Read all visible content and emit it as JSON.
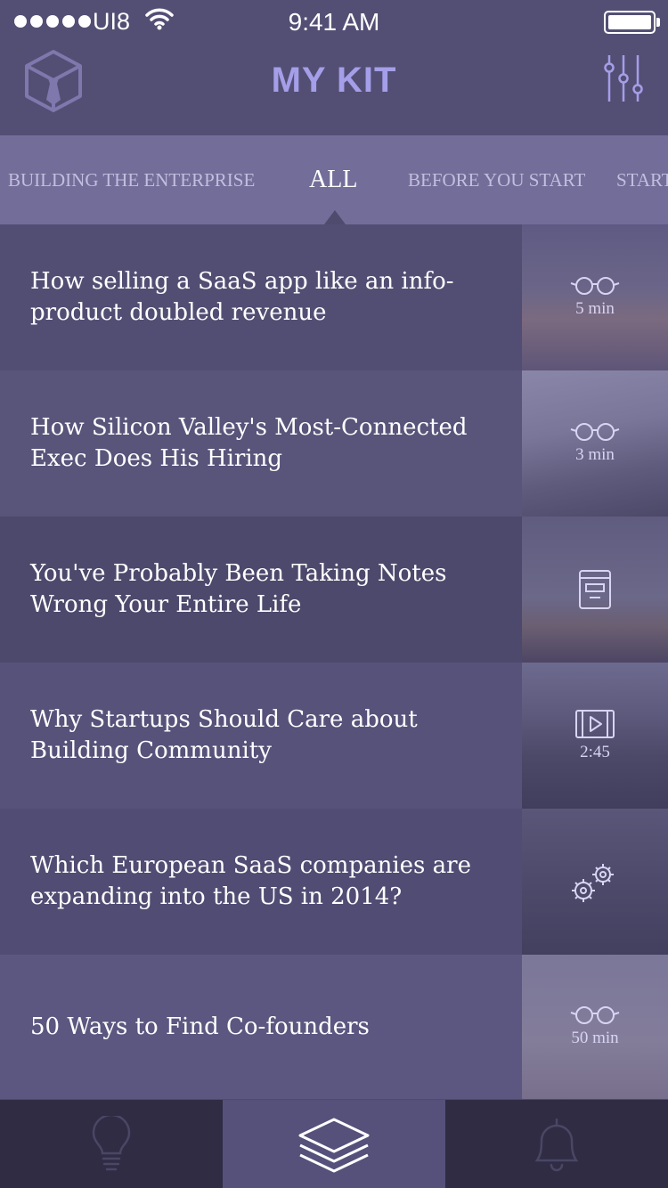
{
  "status_bar": {
    "carrier": "UI8",
    "time": "9:41 AM"
  },
  "header": {
    "title": "MY KIT"
  },
  "tabs": [
    {
      "label": "BUILDING THE ENTERPRISE"
    },
    {
      "label": "ALL",
      "active": true
    },
    {
      "label": "BEFORE YOU START"
    },
    {
      "label": "START"
    }
  ],
  "articles": [
    {
      "title": "How selling a SaaS app like an info-product doubled revenue",
      "type": "read",
      "icon": "glasses-icon",
      "meta": "5 min"
    },
    {
      "title": "How Silicon Valley's Most-Connected Exec Does His Hiring",
      "type": "read",
      "icon": "glasses-icon",
      "meta": "3 min"
    },
    {
      "title": "You've Probably Been Taking Notes Wrong Your Entire Life",
      "type": "book",
      "icon": "book-icon",
      "meta": ""
    },
    {
      "title": "Why Startups Should Care about Building Community",
      "type": "video",
      "icon": "video-icon",
      "meta": "2:45"
    },
    {
      "title": "Which European SaaS companies are expanding into the US in 2014?",
      "type": "tool",
      "icon": "gears-icon",
      "meta": ""
    },
    {
      "title": "50 Ways to Find Co-founders",
      "type": "read",
      "icon": "glasses-icon",
      "meta": "50 min"
    }
  ],
  "tab_bar": [
    {
      "icon": "lightbulb-icon",
      "active": false
    },
    {
      "icon": "layers-icon",
      "active": true
    },
    {
      "icon": "bell-icon",
      "active": false
    }
  ],
  "colors": {
    "title": "#a59ee8",
    "header_bg": "#534f74",
    "tabs_bg": "#736d99",
    "tabbar_bg": "#2f2c44"
  }
}
